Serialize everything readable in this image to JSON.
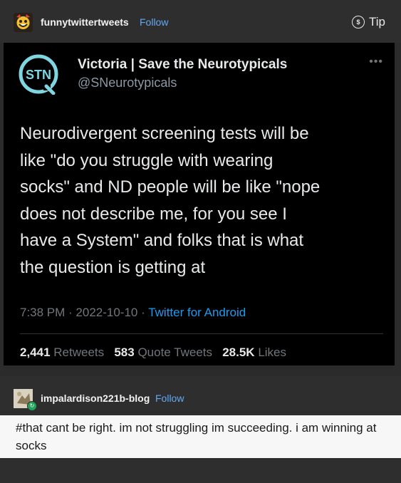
{
  "post": {
    "poster": "funnytwittertweets",
    "follow_label": "Follow",
    "tip_label": "Tip",
    "tip_icon": "dollar-circle-icon"
  },
  "tweet": {
    "display_name": "Victoria | Save the Neurotypicals",
    "handle": "@SNeurotypicals",
    "logo_text": "STN",
    "more_icon": "ellipsis-icon",
    "body": "Neurodivergent screening tests will be\nlike \"do you struggle with wearing\nsocks\" and ND people will be like \"nope\ndoes not describe me, for you see I\nhave a System\" and folks that is what\nthe question is getting at",
    "time": "7:38 PM",
    "date": "2022-10-10",
    "client": "Twitter for Android",
    "separator": " · ",
    "retweets_count": "2,441",
    "retweets_label": "Retweets",
    "quotes_count": "583",
    "quotes_label": "Quote Tweets",
    "likes_count": "28.5K",
    "likes_label": "Likes",
    "accent": "#1d9bf0"
  },
  "reblog": {
    "blog_name": "impalardison221b-blog",
    "follow_label": "Follow",
    "text": "#that cant be right. im not struggling im succeeding. i am winning at socks"
  }
}
